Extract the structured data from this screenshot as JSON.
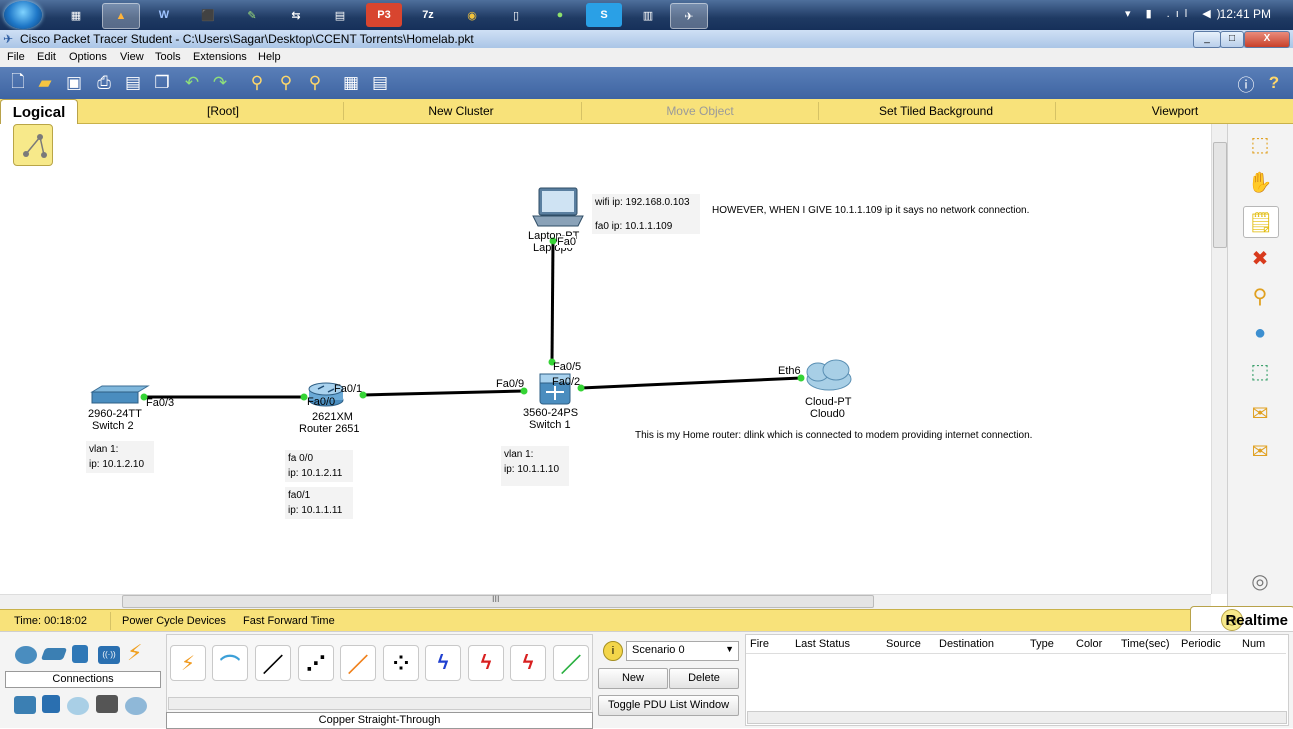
{
  "taskbar": {
    "clock": "12:41 PM",
    "tray_text": "▾ ▮ .ıl ◀)",
    "apps": [
      "W",
      "P3",
      "7z"
    ]
  },
  "window": {
    "title": "Cisco Packet Tracer Student - C:\\Users\\Sagar\\Desktop\\CCENT Torrents\\Homelab.pkt",
    "minimize": "_",
    "maximize": "□",
    "close": "X"
  },
  "menu": [
    "File",
    "Edit",
    "Options",
    "View",
    "Tools",
    "Extensions",
    "Help"
  ],
  "logical_bar": {
    "tab": "Logical",
    "root": "[Root]",
    "new_cluster": "New Cluster",
    "move_object": "Move Object",
    "set_tiled_background": "Set Tiled Background",
    "viewport": "Viewport"
  },
  "devices": {
    "laptop": {
      "model": "Laptop-PT",
      "name": "Laptop0",
      "port": "Fa0"
    },
    "switch2": {
      "model": "2960-24TT",
      "name": "Switch 2",
      "port": "Fa0/3"
    },
    "router": {
      "model": "2621XM",
      "name": "Router 2651",
      "port_left": "Fa0/0",
      "port_right": "Fa0/1"
    },
    "switch1": {
      "model": "3560-24PS",
      "name": "Switch 1",
      "port_top": "Fa0/5",
      "port_left": "Fa0/9",
      "port_right": "Fa0/2"
    },
    "cloud": {
      "model": "Cloud-PT",
      "name": "Cloud0",
      "port": "Eth6"
    }
  },
  "notes": {
    "laptop_wifi": "wifi ip: 192.168.0.103",
    "laptop_fa0": "fa0 ip: 10.1.1.109",
    "however": "HOWEVER, WHEN I GIVE 10.1.1.109 ip it says no network connection.",
    "switch2_vlan": "vlan 1:",
    "switch2_ip": "ip: 10.1.2.10",
    "router_fa00": "fa 0/0",
    "router_fa00_ip": "ip: 10.1.2.11",
    "router_fa01": "fa0/1",
    "router_fa01_ip": "ip: 10.1.1.11",
    "switch1_vlan": "vlan 1:",
    "switch1_ip": "ip: 10.1.1.10",
    "cloud_note": "This is my Home router: dlink which is connected to modem providing internet connection."
  },
  "timebar": {
    "time": "Time: 00:18:02",
    "power_cycle": "Power Cycle Devices",
    "fast_forward": "Fast Forward Time",
    "realtime": "Realtime"
  },
  "bottom": {
    "connections_label": "Connections",
    "cable_label": "Copper Straight-Through",
    "scenario": "Scenario 0",
    "new": "New",
    "delete": "Delete",
    "toggle": "Toggle PDU List Window",
    "pdu_headers": [
      "Fire",
      "Last Status",
      "Source",
      "Destination",
      "Type",
      "Color",
      "Time(sec)",
      "Periodic",
      "Num"
    ],
    "scroll_mark": "III"
  }
}
